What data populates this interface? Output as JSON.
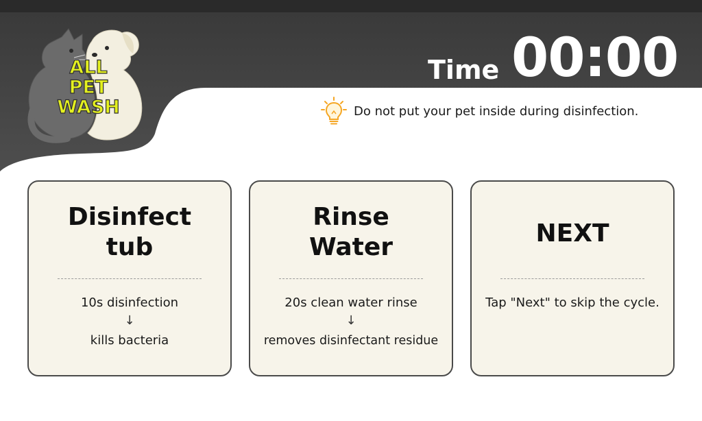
{
  "logo": {
    "line1": "ALL",
    "line2": "PET",
    "line3": "WASH"
  },
  "header": {
    "time_label": "Time",
    "time_value": "00:00"
  },
  "notice": {
    "icon": "lightbulb-icon",
    "text": "Do not put your pet inside during disinfection."
  },
  "cards": [
    {
      "title_line1": "Disinfect",
      "title_line2": "tub",
      "desc_line1": "10s disinfection",
      "arrow": "↓",
      "desc_line2": "kills bacteria"
    },
    {
      "title_line1": "Rinse",
      "title_line2": "Water",
      "desc_line1": "20s clean water rinse",
      "arrow": "↓",
      "desc_line2": "removes disinfectant residue"
    },
    {
      "title": "NEXT",
      "desc": "Tap \"Next\" to skip the cycle."
    }
  ],
  "colors": {
    "header_dark": "#4a4a4a",
    "card_bg": "#f7f4ea",
    "card_border": "#4a4a4a",
    "logo_text": "#e4f020",
    "bulb_accent": "#f5a623"
  }
}
